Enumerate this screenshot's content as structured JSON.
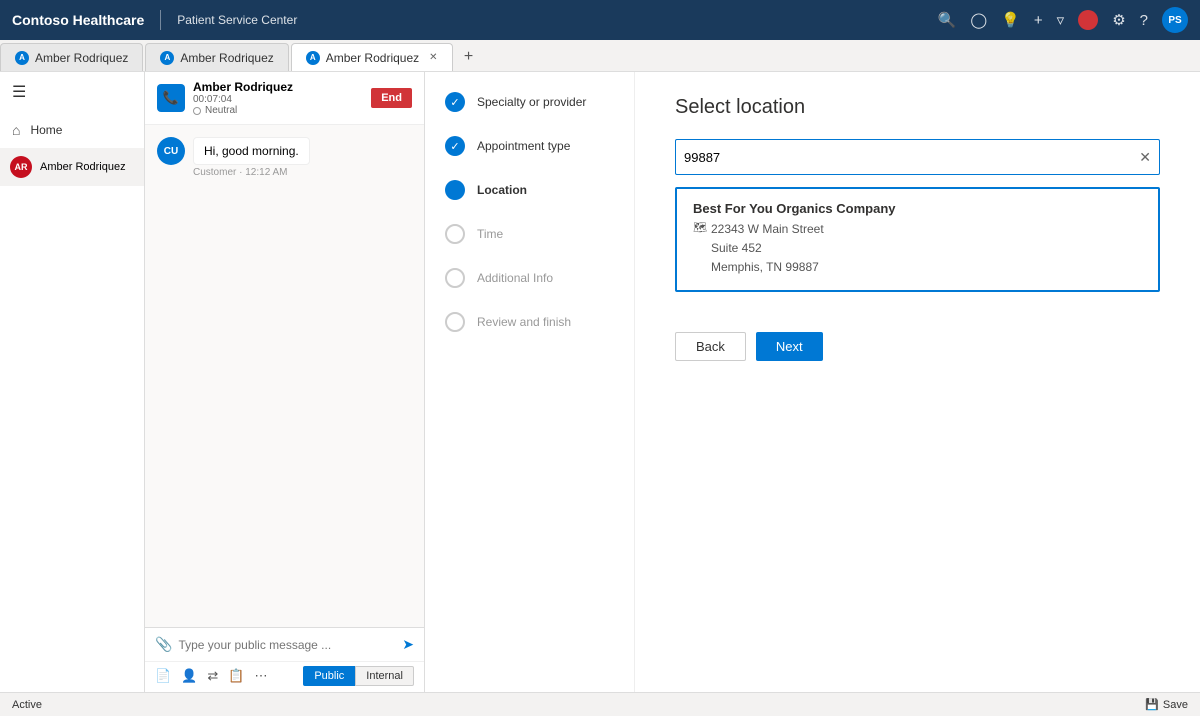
{
  "topbar": {
    "brand": "Contoso Healthcare",
    "subtitle": "Patient Service Center",
    "icons": [
      "search",
      "checkmark-circle",
      "lightbulb",
      "plus",
      "filter",
      "settings",
      "help"
    ],
    "red_dot_label": "",
    "avatar_initials": "PS"
  },
  "tabs": [
    {
      "id": "tab1",
      "label": "Amber Rodriquez",
      "active": false,
      "closeable": false
    },
    {
      "id": "tab2",
      "label": "Amber Rodriquez",
      "active": false,
      "closeable": false
    },
    {
      "id": "tab3",
      "label": "Amber Rodriquez",
      "active": true,
      "closeable": true
    }
  ],
  "sidebar": {
    "home_label": "Home",
    "user_name": "Amber Rodriquez",
    "user_initials": "AR"
  },
  "call": {
    "agent_initials": "AR",
    "caller_name": "Amber Rodriquez",
    "duration": "00:07:04",
    "status": "Neutral",
    "end_button": "End"
  },
  "chat": {
    "message_text": "Hi, good morning.",
    "message_meta": "Customer · 12:12 AM",
    "input_placeholder": "Type your public message ...",
    "msg_avatar": "CU",
    "visibility": {
      "public_label": "Public",
      "internal_label": "Internal"
    }
  },
  "wizard": {
    "steps": [
      {
        "id": "specialty",
        "label": "Specialty or provider",
        "state": "completed"
      },
      {
        "id": "appointment",
        "label": "Appointment type",
        "state": "completed"
      },
      {
        "id": "location",
        "label": "Location",
        "state": "active"
      },
      {
        "id": "time",
        "label": "Time",
        "state": "pending"
      },
      {
        "id": "additional",
        "label": "Additional Info",
        "state": "pending"
      },
      {
        "id": "review",
        "label": "Review and finish",
        "state": "pending"
      }
    ]
  },
  "main": {
    "title": "Select location",
    "search_value": "99887",
    "search_placeholder": "",
    "result": {
      "name": "Best For You Organics Company",
      "street": "22343 W Main Street",
      "suite": "Suite 452",
      "city_state_zip": "Memphis, TN 99887"
    },
    "back_button": "Back",
    "next_button": "Next"
  },
  "statusbar": {
    "status_label": "Active",
    "save_label": "Save"
  }
}
